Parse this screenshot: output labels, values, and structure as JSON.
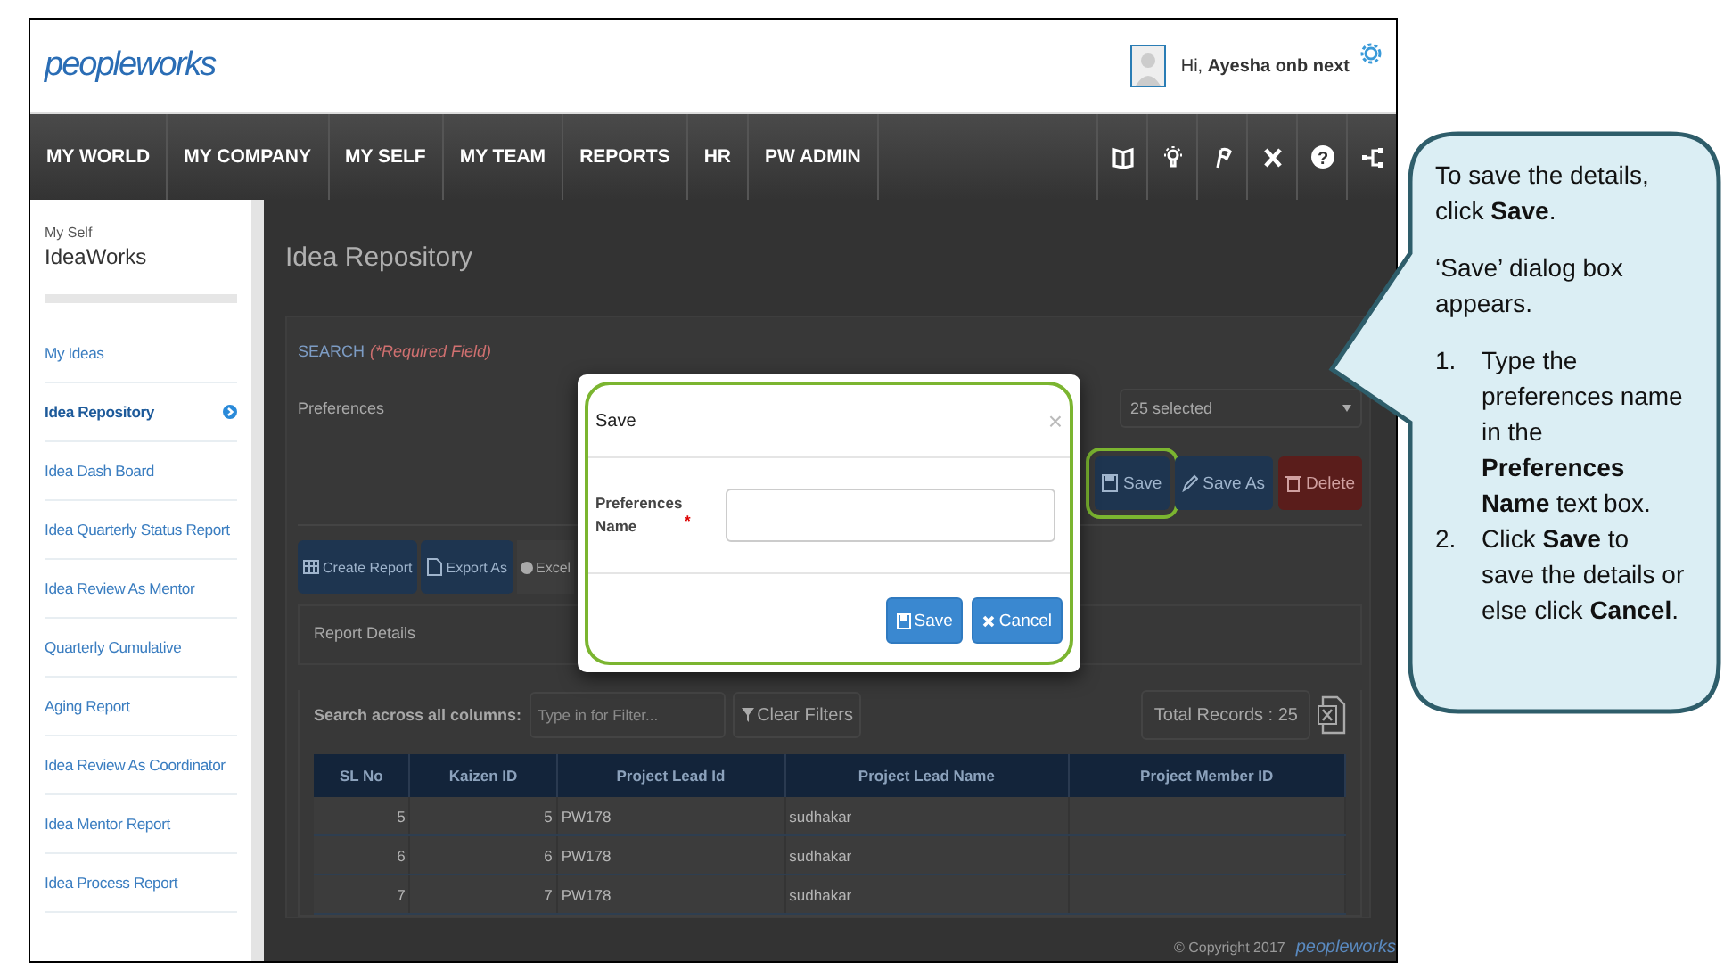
{
  "header": {
    "logo": "peopleworks",
    "greeting": "Hi, **Ayesha onb next**"
  },
  "nav": {
    "items": [
      "MY WORLD",
      "MY COMPANY",
      "MY SELF",
      "MY TEAM",
      "REPORTS",
      "HR",
      "PW ADMIN"
    ],
    "help_icon": "?"
  },
  "sidebar": {
    "section": "My Self",
    "title": "IdeaWorks",
    "items": [
      {
        "label": "My Ideas",
        "selected": false
      },
      {
        "label": "Idea Repository",
        "selected": true
      },
      {
        "label": "Idea Dash Board",
        "selected": false
      },
      {
        "label": "Idea Quarterly Status Report",
        "selected": false
      },
      {
        "label": "Idea Review As Mentor",
        "selected": false
      },
      {
        "label": "Quarterly Cumulative",
        "selected": false
      },
      {
        "label": "Aging Report",
        "selected": false
      },
      {
        "label": "Idea Review As Coordinator",
        "selected": false
      },
      {
        "label": "Idea Mentor Report",
        "selected": false
      },
      {
        "label": "Idea Process Report",
        "selected": false
      }
    ]
  },
  "main": {
    "title": "Idea Repository",
    "search_label": "SEARCH",
    "required_note": "(*Required Field)",
    "preferences_label": "Preferences",
    "preferences_select": "25 selected",
    "buttons": [
      {
        "label": "Save",
        "kind": "save",
        "highlighted": true
      },
      {
        "label": "Save As",
        "kind": "save_as",
        "highlighted": false
      },
      {
        "label": "Delete",
        "kind": "delete",
        "highlighted": false
      }
    ],
    "create_report": "Create Report",
    "export_as": "Export As",
    "format_option": {
      "label": "Excel",
      "selected": true
    },
    "report_title": "Report Details",
    "filter_label": "Search across all columns:",
    "filter_placeholder": "Type in for Filter...",
    "clear_filters": "Clear Filters",
    "total_records": "Total Records : 25",
    "table": {
      "columns": [
        "SL No",
        "Kaizen ID",
        "Project Lead Id",
        "Project Lead Name",
        "Project Member ID"
      ],
      "rows": [
        [
          "5",
          "5",
          "PW178",
          "sudhakar",
          ""
        ],
        [
          "6",
          "6",
          "PW178",
          "sudhakar",
          ""
        ],
        [
          "7",
          "7",
          "PW178",
          "sudhakar",
          ""
        ]
      ]
    }
  },
  "footer": {
    "copyright": "© Copyright 2017",
    "logo": "peopleworks"
  },
  "dialog": {
    "title": "Save",
    "close": "×",
    "field_label": "Preferences Name",
    "required_mark": "*",
    "highlighted": true,
    "buttons": [
      {
        "label": "Save",
        "kind": "save"
      },
      {
        "label": "Cancel",
        "kind": "cancel"
      }
    ]
  },
  "callout": {
    "paragraphs": [
      "To save the details, click **Save**.",
      "‘Save’ dialog box appears."
    ],
    "steps": [
      {
        "number": "1.",
        "text": "Type the preferences name in the **Preferences Name** text box."
      },
      {
        "number": "2.",
        "text": "Click **Save** to save the details or else click **Cancel**."
      }
    ]
  }
}
